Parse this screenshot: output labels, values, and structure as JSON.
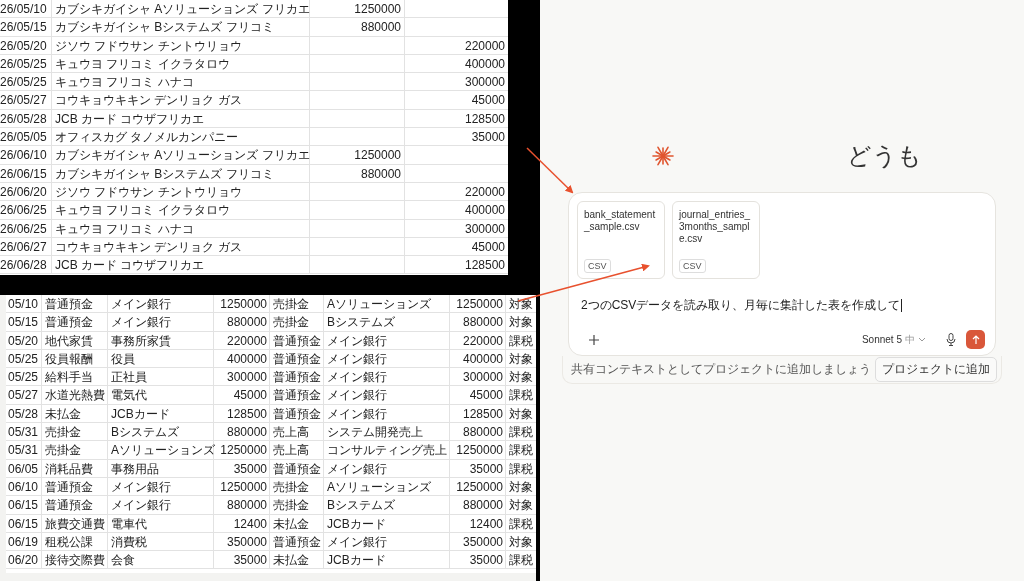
{
  "bank_sheet": {
    "rows": [
      {
        "date": "26/05/10",
        "description": "カブシキガイシャ Aソリューションズ フリカエ",
        "deposit": "1250000"
      },
      {
        "date": "26/05/15",
        "description": "カブシキガイシャ Bシステムズ フリコミ",
        "deposit": "880000"
      },
      {
        "date": "26/05/20",
        "description": "ジソウ フドウサン チントウリョウ",
        "withdrawal": "220000"
      },
      {
        "date": "26/05/25",
        "description": "キュウヨ フリコミ イクラタロウ",
        "withdrawal": "400000"
      },
      {
        "date": "26/05/25",
        "description": "キュウヨ フリコミ ハナコ",
        "withdrawal": "300000"
      },
      {
        "date": "26/05/27",
        "description": "コウキョウキキン デンリョク ガス",
        "withdrawal": "45000"
      },
      {
        "date": "26/05/28",
        "description": "JCB カード コウザフリカエ",
        "withdrawal": "128500"
      },
      {
        "date": "26/05/05",
        "description": "オフィスカグ タノメルカンパニー",
        "withdrawal": "35000"
      },
      {
        "date": "26/06/10",
        "description": "カブシキガイシャ Aソリューションズ フリカエ",
        "deposit": "1250000"
      },
      {
        "date": "26/06/15",
        "description": "カブシキガイシャ Bシステムズ フリコミ",
        "deposit": "880000"
      },
      {
        "date": "26/06/20",
        "description": "ジソウ フドウサン チントウリョウ",
        "withdrawal": "220000"
      },
      {
        "date": "26/06/25",
        "description": "キュウヨ フリコミ イクラタロウ",
        "withdrawal": "400000"
      },
      {
        "date": "26/06/25",
        "description": "キュウヨ フリコミ ハナコ",
        "withdrawal": "300000"
      },
      {
        "date": "26/06/27",
        "description": "コウキョウキキン デンリョク ガス",
        "withdrawal": "45000"
      },
      {
        "date": "26/06/28",
        "description": "JCB カード コウザフリカエ",
        "withdrawal": "128500"
      }
    ]
  },
  "journal_sheet": {
    "rows": [
      {
        "date": "05/10",
        "debit_account": "普通預金",
        "debit_sub": "メイン銀行",
        "debit_amount": "1250000",
        "credit_account": "売掛金",
        "credit_sub": "Aソリューションズ",
        "credit_amount": "1250000",
        "tax": "対象"
      },
      {
        "date": "05/15",
        "debit_account": "普通預金",
        "debit_sub": "メイン銀行",
        "debit_amount": "880000",
        "credit_account": "売掛金",
        "credit_sub": "Bシステムズ",
        "credit_amount": "880000",
        "tax": "対象"
      },
      {
        "date": "05/20",
        "debit_account": "地代家賃",
        "debit_sub": "事務所家賃",
        "debit_amount": "220000",
        "credit_account": "普通預金",
        "credit_sub": "メイン銀行",
        "credit_amount": "220000",
        "tax": "課税"
      },
      {
        "date": "05/25",
        "debit_account": "役員報酬",
        "debit_sub": "役員",
        "debit_amount": "400000",
        "credit_account": "普通預金",
        "credit_sub": "メイン銀行",
        "credit_amount": "400000",
        "tax": "対象"
      },
      {
        "date": "05/25",
        "debit_account": "給料手当",
        "debit_sub": "正社員",
        "debit_amount": "300000",
        "credit_account": "普通預金",
        "credit_sub": "メイン銀行",
        "credit_amount": "300000",
        "tax": "対象"
      },
      {
        "date": "05/27",
        "debit_account": "水道光熱費",
        "debit_sub": "電気代",
        "debit_amount": "45000",
        "credit_account": "普通預金",
        "credit_sub": "メイン銀行",
        "credit_amount": "45000",
        "tax": "課税"
      },
      {
        "date": "05/28",
        "debit_account": "未払金",
        "debit_sub": "JCBカード",
        "debit_amount": "128500",
        "credit_account": "普通預金",
        "credit_sub": "メイン銀行",
        "credit_amount": "128500",
        "tax": "対象"
      },
      {
        "date": "05/31",
        "debit_account": "売掛金",
        "debit_sub": "Bシステムズ",
        "debit_amount": "880000",
        "credit_account": "売上高",
        "credit_sub": "システム開発売上",
        "credit_amount": "880000",
        "tax": "課税"
      },
      {
        "date": "05/31",
        "debit_account": "売掛金",
        "debit_sub": "Aソリューションズ",
        "debit_amount": "1250000",
        "credit_account": "売上高",
        "credit_sub": "コンサルティング売上",
        "credit_amount": "1250000",
        "tax": "課税"
      },
      {
        "date": "06/05",
        "debit_account": "消耗品費",
        "debit_sub": "事務用品",
        "debit_amount": "35000",
        "credit_account": "普通預金",
        "credit_sub": "メイン銀行",
        "credit_amount": "35000",
        "tax": "課税"
      },
      {
        "date": "06/10",
        "debit_account": "普通預金",
        "debit_sub": "メイン銀行",
        "debit_amount": "1250000",
        "credit_account": "売掛金",
        "credit_sub": "Aソリューションズ",
        "credit_amount": "1250000",
        "tax": "対象"
      },
      {
        "date": "06/15",
        "debit_account": "普通預金",
        "debit_sub": "メイン銀行",
        "debit_amount": "880000",
        "credit_account": "売掛金",
        "credit_sub": "Bシステムズ",
        "credit_amount": "880000",
        "tax": "対象"
      },
      {
        "date": "06/15",
        "debit_account": "旅費交通費",
        "debit_sub": "電車代",
        "debit_amount": "12400",
        "credit_account": "未払金",
        "credit_sub": "JCBカード",
        "credit_amount": "12400",
        "tax": "課税"
      },
      {
        "date": "06/19",
        "debit_account": "租税公課",
        "debit_sub": "消費税",
        "debit_amount": "350000",
        "credit_account": "普通預金",
        "credit_sub": "メイン銀行",
        "credit_amount": "350000",
        "tax": "対象"
      },
      {
        "date": "06/20",
        "debit_account": "接待交際費",
        "debit_sub": "会食",
        "debit_amount": "35000",
        "credit_account": "未払金",
        "credit_sub": "JCBカード",
        "credit_amount": "35000",
        "tax": "課税"
      }
    ]
  },
  "chat": {
    "greeting": "どうも",
    "attachments": [
      {
        "name": "bank_statement_sample.csv",
        "type": "CSV"
      },
      {
        "name": "journal_entries_3months_sample.csv",
        "type": "CSV"
      }
    ],
    "message": "2つのCSVデータを読み取り、月毎に集計した表を作成して",
    "model": "Sonnet 5",
    "effort": "中",
    "project_hint": "共有コンテキストとしてプロジェクトに追加しましょう",
    "project_button": "プロジェクトに追加"
  }
}
